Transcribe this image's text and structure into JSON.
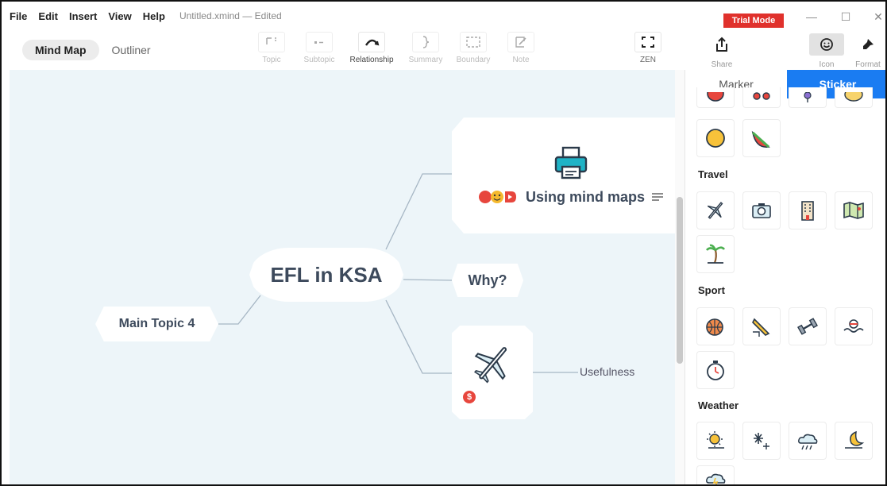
{
  "menu": {
    "items": [
      "File",
      "Edit",
      "Insert",
      "View",
      "Help"
    ],
    "filename": "Untitled.xmind",
    "status": "— Edited"
  },
  "trial_badge": "Trial Mode",
  "window_controls": {
    "minimize": "—",
    "maximize": "☐",
    "close": "✕"
  },
  "modes": {
    "mind_map": "Mind Map",
    "outliner": "Outliner"
  },
  "toolbar": {
    "topic": "Topic",
    "subtopic": "Subtopic",
    "relationship": "Relationship",
    "summary": "Summary",
    "boundary": "Boundary",
    "note": "Note",
    "zen": "ZEN",
    "share": "Share",
    "icon": "Icon",
    "format": "Format"
  },
  "map": {
    "central": "EFL in KSA",
    "why": "Why?",
    "main_topic": "Main Topic 4",
    "mind_maps": "Using mind maps",
    "usefulness": "Usefulness",
    "dollar_marker": "$"
  },
  "panel": {
    "tabs": [
      "Marker",
      "Sticker"
    ],
    "active_tab": "Sticker",
    "sections": {
      "travel": "Travel",
      "sport": "Sport",
      "weather": "Weather"
    }
  },
  "colors": {
    "accent": "#1a7cf2",
    "trial": "#e0312c",
    "canvas": "#edf5f9",
    "node_text": "#3d4a5c"
  }
}
